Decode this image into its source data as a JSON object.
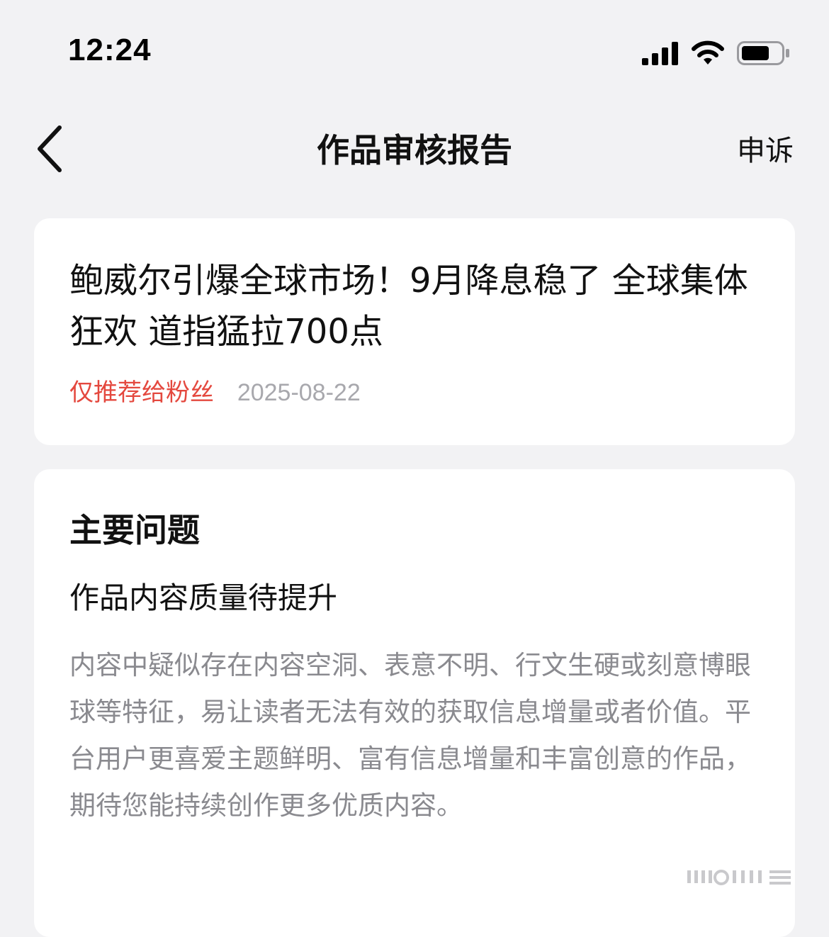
{
  "status_bar": {
    "time": "12:24"
  },
  "nav": {
    "title": "作品审核报告",
    "appeal_label": "申诉"
  },
  "article": {
    "title": "鲍威尔引爆全球市场！9月降息稳了 全球集体狂欢 道指猛拉700点",
    "status": "仅推荐给粉丝",
    "date": "2025-08-22"
  },
  "issue": {
    "heading": "主要问题",
    "subtitle": "作品内容质量待提升",
    "description": "内容中疑似存在内容空洞、表意不明、行文生硬或刻意博眼球等特征，易让读者无法有效的获取信息增量或者价值。平台用户更喜爱主题鲜明、富有信息增量和丰富创意的作品，期待您能持续创作更多优质内容。"
  },
  "colors": {
    "background": "#f2f2f4",
    "card": "#ffffff",
    "status_red": "#e4483e",
    "muted_text": "#8a8a8f",
    "date_gray": "#a8a8ad"
  },
  "icons": [
    "signal-icon",
    "wifi-icon",
    "battery-icon",
    "back-arrow-icon"
  ]
}
